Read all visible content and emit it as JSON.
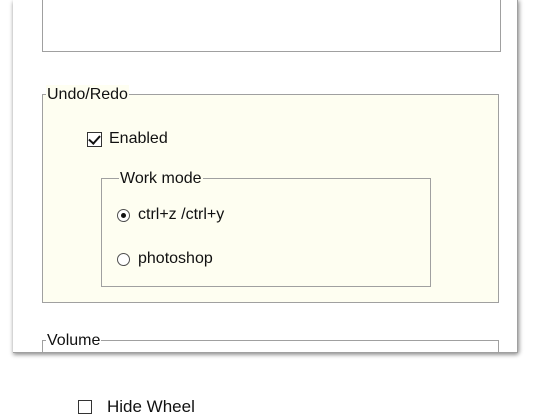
{
  "settings": {
    "undo_redo": {
      "title": "Undo/Redo",
      "enabled_label": "Enabled",
      "enabled_checked": true,
      "work_mode": {
        "title": "Work mode",
        "options": [
          {
            "label": "ctrl+z /ctrl+y",
            "selected": true
          },
          {
            "label": "photoshop",
            "selected": false
          }
        ]
      }
    },
    "volume": {
      "title": "Volume"
    }
  },
  "scrollbar": {
    "up_icon": "^",
    "down_icon": "v"
  },
  "bottom": {
    "hide_wheel_label": "Hide Wheel",
    "hide_wheel_checked": false
  },
  "colors": {
    "panel_background": "#ffffff",
    "group_background": "#fefef1",
    "border": "#a0a0a0",
    "scrollbar_thumb": "#cdcdcd"
  }
}
